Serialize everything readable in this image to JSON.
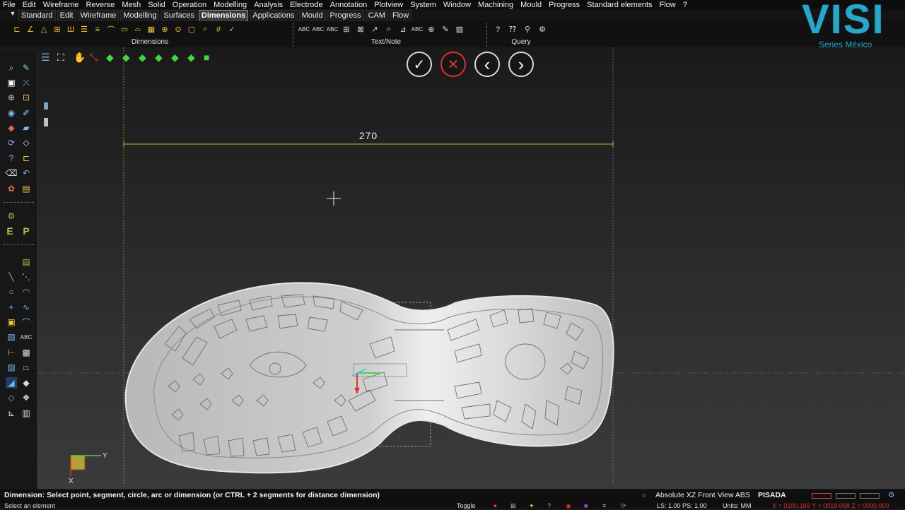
{
  "menu": [
    "File",
    "Edit",
    "Wireframe",
    "Reverse",
    "Mesh",
    "Solid",
    "Operation",
    "Modelling",
    "Analysis",
    "Electrode",
    "Annotation",
    "Plotview",
    "System",
    "Window",
    "Machining",
    "Mould",
    "Progress",
    "Standard elements",
    "Flow",
    "?"
  ],
  "tabs": [
    "Standard",
    "Edit",
    "Wireframe",
    "Modelling",
    "Surfaces",
    "Dimensions",
    "Applications",
    "Mould",
    "Progress",
    "CAM",
    "Flow"
  ],
  "active_tab": "Dimensions",
  "ribbon": {
    "groups": [
      {
        "label": "Dimensions"
      },
      {
        "label": "Text/Note"
      },
      {
        "label": "Query"
      }
    ]
  },
  "logo": {
    "title": "VISI",
    "subtitle": "Series México"
  },
  "dialog": {
    "confirm": "✓",
    "cancel": "✕",
    "back": "‹",
    "next": "›"
  },
  "dimension": {
    "value": "270"
  },
  "status": {
    "prompt": "Dimension: Select point, segment, circle, arc or dimension (or CTRL + 2 segments for distance dimension)",
    "hint": "Select an element",
    "view": "Absolute XZ Front",
    "view_abs": "View ABS",
    "layer": "PISADA",
    "toggle": "Toggle",
    "ls": "LS: 1.00 PS: 1.00",
    "units": "Units: MM",
    "coords": "X = 0100.169 Y = 0019.068 Z = 0000.000"
  },
  "axes": {
    "x": "X",
    "y": "Y"
  },
  "colors": {
    "accent_green": "#9ec93f",
    "logo": "#2aa6c8",
    "cancel_red": "#e03030"
  }
}
